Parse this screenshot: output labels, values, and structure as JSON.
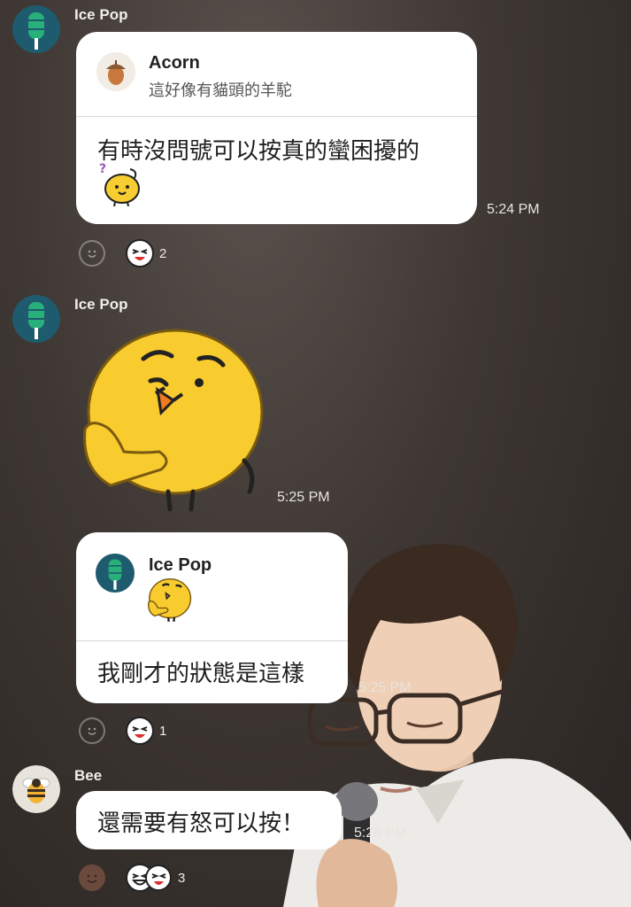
{
  "messages": [
    {
      "sender": "Ice Pop",
      "reply_to": {
        "name": "Acorn",
        "text": "這好像有貓頭的羊駝"
      },
      "text": "有時沒問號可以按真的蠻困擾的",
      "time": "5:24 PM",
      "reactions": {
        "count": "2"
      }
    },
    {
      "sender": "Ice Pop",
      "sticker": "thinking-chick-sticker",
      "time": "5:25 PM"
    },
    {
      "reply_to": {
        "name": "Ice Pop"
      },
      "text": "我剛才的狀態是這樣",
      "time": "5:25 PM",
      "reactions": {
        "count": "1"
      }
    },
    {
      "sender": "Bee",
      "text": "還需要有怒可以按！",
      "time": "5:26 PM",
      "reactions": {
        "count": "3"
      }
    }
  ],
  "icons": {
    "icepop_avatar": "popsicle-icon",
    "acorn_avatar": "acorn-icon",
    "bee_avatar": "bee-icon",
    "add_reaction": "smiley-icon"
  },
  "colors": {
    "bubble": "#ffffff",
    "icepop_avatar_bg": "#1f5b6e",
    "popsicle": "#28b07a",
    "bee_avatar_bg": "#e8e4dc",
    "sticker_yellow": "#f8cb2e"
  }
}
